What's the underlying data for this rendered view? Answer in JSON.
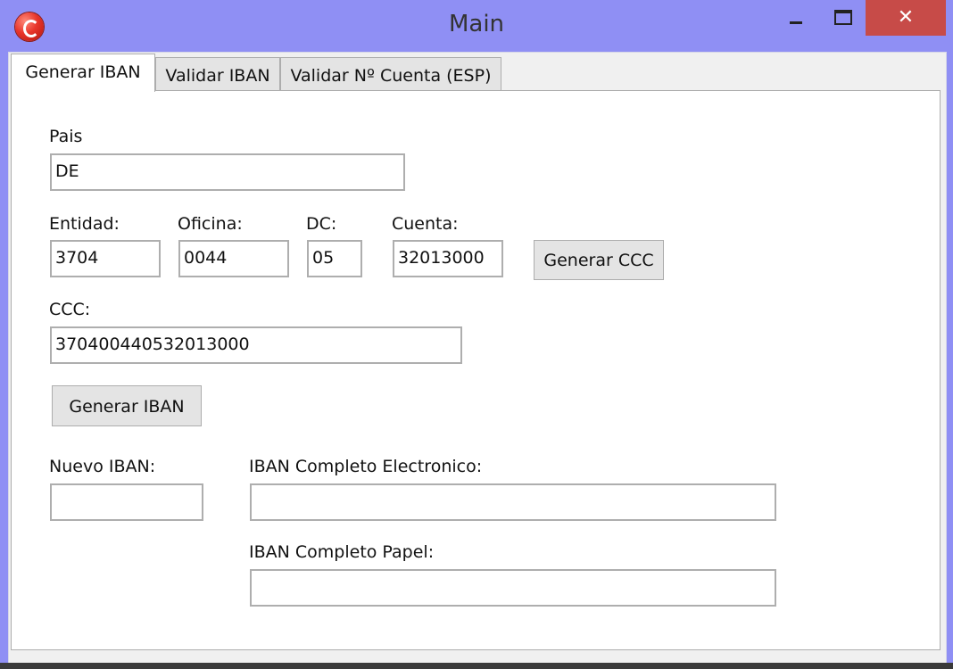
{
  "window": {
    "title": "Main",
    "close_glyph": "✕"
  },
  "tabs": [
    "Generar IBAN",
    "Validar IBAN",
    "Validar Nº Cuenta (ESP)"
  ],
  "form": {
    "pais": {
      "label": "Pais",
      "value": "DE"
    },
    "entidad": {
      "label": "Entidad:",
      "value": "3704"
    },
    "oficina": {
      "label": "Oficina:",
      "value": "0044"
    },
    "dc": {
      "label": "DC:",
      "value": "05"
    },
    "cuenta": {
      "label": "Cuenta:",
      "value": "32013000"
    },
    "generar_ccc_label": "Generar CCC",
    "ccc": {
      "label": "CCC:",
      "value": "370400440532013000"
    },
    "generar_iban_label": "Generar IBAN",
    "nuevo_iban": {
      "label": "Nuevo IBAN:",
      "value": ""
    },
    "iban_electronico": {
      "label": "IBAN Completo Electronico:",
      "value": ""
    },
    "iban_papel": {
      "label": "IBAN Completo Papel:",
      "value": ""
    }
  }
}
